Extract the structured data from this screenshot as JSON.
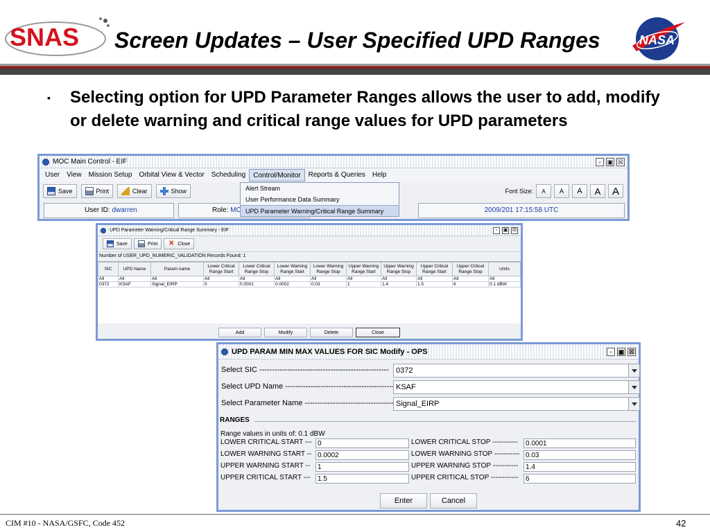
{
  "slide": {
    "logo_text": "SNAS",
    "title": "Screen Updates – User Specified UPD Ranges",
    "nasa_logo_text": "NASA",
    "bullet_mark": "▪",
    "bullet": "Selecting option for UPD Parameter Ranges allows the user to add, modify or delete warning and critical range values for UPD parameters",
    "footer_left": "CIM #10 - NASA/GSFC, Code 452",
    "page_number": "42"
  },
  "colors": {
    "brand_red": "#d4121e",
    "nasa_blue": "#1d3c8f",
    "window_border": "#7a9ad4",
    "link_blue": "#1a3aa8"
  },
  "moc": {
    "title": "MOC Main Control - EIF",
    "window_buttons": [
      "▫",
      "▣",
      "☒"
    ],
    "menu": [
      "User",
      "View",
      "Mission Setup",
      "Orbital View & Vector",
      "Scheduling",
      "Control/Monitor",
      "Reports & Queries",
      "Help"
    ],
    "toolbar": {
      "save": "Save",
      "print": "Print",
      "clear": "Clear",
      "show": "Show",
      "font_size_label": "Font Size:",
      "font_buttons": [
        "A",
        "A",
        "A",
        "A",
        "A"
      ]
    },
    "dropdown": [
      "Alert Stream",
      "User Performance Data Summary",
      "UPD Parameter Warning/Critical Range Summary"
    ],
    "status": {
      "user_label": "User ID:",
      "user_value": "dwarren",
      "role_label": "Role:",
      "role_value": "MC",
      "time": "2009/201 17:15:58 UTC"
    }
  },
  "upd_summary": {
    "title": "UPD Parameter Warning/Critical Range Summary - EIF",
    "window_buttons": [
      "▫",
      "▣",
      "☒"
    ],
    "toolbar": {
      "save": "Save",
      "print": "Print",
      "close": "Close"
    },
    "record_count": "Number of USER_UPD_NUMERIC_VALIDATION Records Found: 1",
    "columns": [
      "SIC",
      "UPD Name",
      "Param name",
      "Lower Critical Range Start",
      "Lower Critical Range Stop",
      "Lower Warning Range Start",
      "Lower Warning Range Stop",
      "Upper Warning Range Start",
      "Upper Warning Range Stop",
      "Upper Critical Range Start",
      "Upper Critical Range Stop",
      "Units"
    ],
    "rows": [
      [
        "All",
        "All",
        "All",
        "All",
        "All",
        "All",
        "All",
        "All",
        "All",
        "All",
        "All",
        "All"
      ],
      [
        "0372",
        "KSAF",
        "Signal_EIRP",
        "0",
        "0.0001",
        "0.0002",
        "0.03",
        "1",
        "1.4",
        "1.5",
        "6",
        "0.1 dBW"
      ]
    ],
    "buttons": [
      "Add",
      "Modify",
      "Delete",
      "Close"
    ]
  },
  "modify": {
    "title": "UPD PARAM MIN MAX VALUES FOR SIC Modify - OPS",
    "window_buttons": [
      "▫",
      "▣",
      "☒"
    ],
    "fields": [
      {
        "label": "Select SIC ---------------------------------------------------",
        "value": "0372"
      },
      {
        "label": "Select UPD Name -------------------------------------------",
        "value": "KSAF"
      },
      {
        "label": "Select Parameter Name ------------------------------------",
        "value": "Signal_EIRP"
      }
    ],
    "ranges_heading": "RANGES",
    "units_line": "Range values in units of:  0.1 dBW",
    "ranges": [
      {
        "left_label": "LOWER CRITICAL START ---",
        "left_value": "0",
        "right_label": "LOWER CRITICAL STOP -----------",
        "right_value": "0.0001"
      },
      {
        "left_label": "LOWER WARNING START --",
        "left_value": "0.0002",
        "right_label": "LOWER WARNING STOP -----------",
        "right_value": "0.03"
      },
      {
        "left_label": "UPPER WARNING START --",
        "left_value": "1",
        "right_label": "UPPER WARNING STOP -----------",
        "right_value": "1.4"
      },
      {
        "left_label": "UPPER CRITICAL START ---",
        "left_value": "1.5",
        "right_label": "UPPER CRITICAL STOP ------------",
        "right_value": "6"
      }
    ],
    "buttons": [
      "Enter",
      "Cancel"
    ]
  }
}
